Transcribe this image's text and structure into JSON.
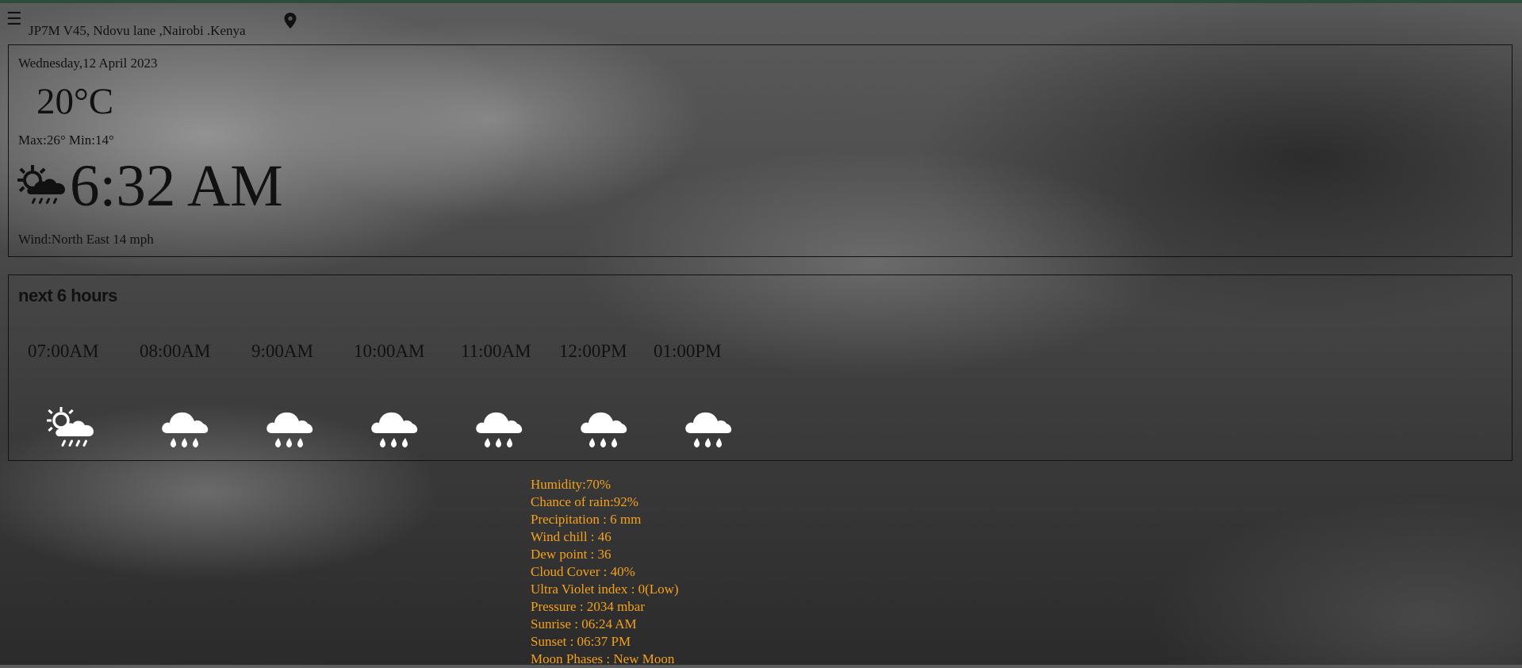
{
  "header": {
    "menu_icon": "hamburger-menu-icon",
    "location": "JP7M V45, Ndovu lane ,Nairobi .Kenya",
    "pin_icon": "map-pin-icon"
  },
  "current": {
    "date": "Wednesday,12 April 2023",
    "temperature": "20°C",
    "max_min": "Max:26° Min:14°",
    "weather_icon": "sun-cloud-rain-icon",
    "time": "6:32 AM",
    "wind": "Wind:North East 14 mph"
  },
  "forecast": {
    "title": "next 6 hours",
    "hours": [
      {
        "label": "07:00AM",
        "icon": "sun-cloud-rain-icon"
      },
      {
        "label": "08:00AM",
        "icon": "cloud-rain-icon"
      },
      {
        "label": "9:00AM",
        "icon": "cloud-rain-icon"
      },
      {
        "label": "10:00AM",
        "icon": "cloud-rain-icon"
      },
      {
        "label": "11:00AM",
        "icon": "cloud-rain-icon"
      },
      {
        "label": "12:00PM",
        "icon": "cloud-rain-icon"
      },
      {
        "label": "01:00PM",
        "icon": "cloud-rain-icon"
      }
    ]
  },
  "details": [
    "Humidity:70%",
    "Chance of rain:92%",
    "Precipitation : 6 mm",
    "Wind chill : 46",
    "Dew point : 36",
    "Cloud Cover : 40%",
    "Ultra Violet index : 0(Low)",
    "Pressure : 2034 mbar",
    "Sunrise : 06:24 AM",
    "Sunset : 06:37 PM",
    "Moon Phases : New Moon"
  ],
  "colors": {
    "detail_text": "#f5a11d",
    "top_strip": "#2f4d3c",
    "hour_icon": "#ffffff",
    "text": "#111111"
  }
}
